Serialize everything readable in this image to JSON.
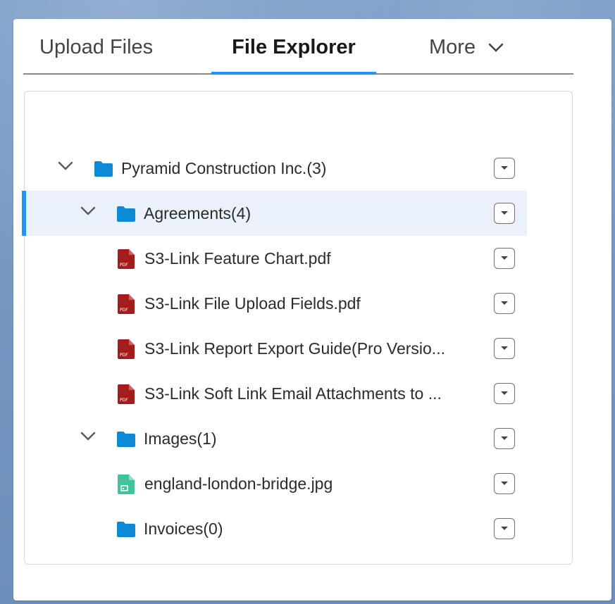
{
  "tabs": [
    {
      "label": "Upload Files",
      "active": false
    },
    {
      "label": "File Explorer",
      "active": true
    },
    {
      "label": "More",
      "active": false
    }
  ],
  "colors": {
    "accent": "#1b96ff",
    "folder": "#0b8bd6",
    "pdf": "#a61c1c",
    "image": "#3fc49b",
    "selected_row": "#eaf1fb"
  },
  "tree": [
    {
      "label": "Pyramid Construction Inc.(3)",
      "type": "folder",
      "level": 0,
      "expanded": true,
      "icon": "folder-icon"
    },
    {
      "label": "Agreements(4)",
      "type": "folder",
      "level": 1,
      "expanded": true,
      "selected": true,
      "icon": "folder-icon"
    },
    {
      "label": "S3-Link Feature Chart.pdf",
      "type": "pdf",
      "level": 2,
      "icon": "pdf-file-icon"
    },
    {
      "label": "S3-Link File Upload Fields.pdf",
      "type": "pdf",
      "level": 2,
      "icon": "pdf-file-icon"
    },
    {
      "label": "S3-Link Report Export Guide(Pro Versio...",
      "type": "pdf",
      "level": 2,
      "icon": "pdf-file-icon"
    },
    {
      "label": "S3-Link Soft Link Email Attachments to ...",
      "type": "pdf",
      "level": 2,
      "icon": "pdf-file-icon"
    },
    {
      "label": "Images(1)",
      "type": "folder",
      "level": 1,
      "expanded": true,
      "icon": "folder-icon"
    },
    {
      "label": "england-london-bridge.jpg",
      "type": "image",
      "level": 2,
      "icon": "image-file-icon"
    },
    {
      "label": "Invoices(0)",
      "type": "folder",
      "level": 1,
      "expanded": false,
      "icon": "folder-icon"
    }
  ]
}
